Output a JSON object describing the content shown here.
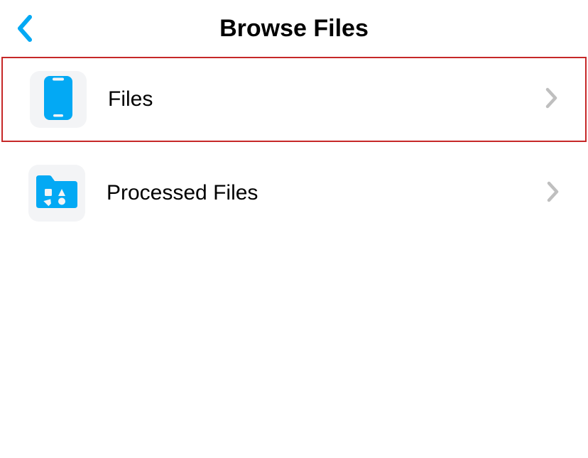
{
  "header": {
    "title": "Browse Files"
  },
  "items": [
    {
      "label": "Files",
      "icon": "phone-icon",
      "highlighted": true
    },
    {
      "label": "Processed Files",
      "icon": "folder-shapes-icon",
      "highlighted": false
    }
  ],
  "colors": {
    "accent": "#03A9F4",
    "highlight_border": "#c62828",
    "chevron": "#bfbfbf"
  }
}
